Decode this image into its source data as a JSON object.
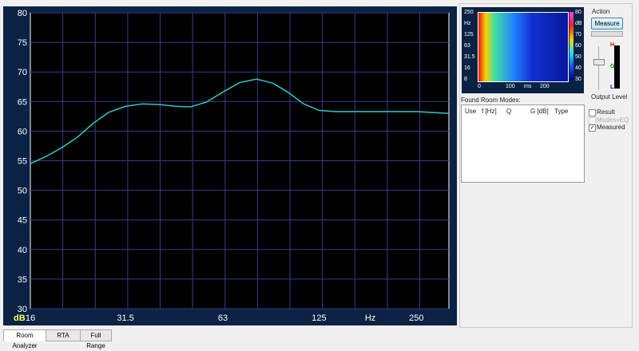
{
  "main_plot": {
    "y_axis_unit": "dB",
    "x_axis_unit": "Hz"
  },
  "chart_data": {
    "type": "line",
    "xscale": "log",
    "xlim": [
      16,
      315
    ],
    "ylim": [
      30,
      80
    ],
    "yticks": [
      "30",
      "35",
      "40",
      "45",
      "50",
      "55",
      "60",
      "65",
      "70",
      "75",
      "80"
    ],
    "xticks": [
      {
        "v": 16,
        "label": "16"
      },
      {
        "v": 31.5,
        "label": "31.5"
      },
      {
        "v": 63,
        "label": "63"
      },
      {
        "v": 125,
        "label": "125"
      },
      {
        "v": 250,
        "label": "250"
      }
    ],
    "xlabel": "Hz",
    "ylabel": "dB",
    "line_color": "#2ec8c8",
    "series": [
      {
        "name": "Measured",
        "x": [
          16,
          18,
          20,
          22.4,
          25,
          28,
          31.5,
          35.5,
          40,
          45,
          50,
          56,
          63,
          71,
          80,
          90,
          100,
          112,
          125,
          140,
          160,
          200,
          250,
          315
        ],
        "y": [
          54.5,
          55.8,
          57.2,
          59,
          61.3,
          63.2,
          64.2,
          64.6,
          64.5,
          64.2,
          64.1,
          64.9,
          66.6,
          68.2,
          68.8,
          68.1,
          66.6,
          64.6,
          63.5,
          63.3,
          63.3,
          63.3,
          63.3,
          63.0
        ]
      }
    ]
  },
  "spectrogram": {
    "y_ticks": [
      "250",
      "Hz",
      "125",
      "63",
      "31.5",
      "16",
      "8"
    ],
    "x_ticks": [
      "0",
      "100",
      "ms",
      "200"
    ],
    "scale_ticks": [
      "80",
      "dB",
      "70",
      "60",
      "50",
      "40",
      "30"
    ]
  },
  "action": {
    "title": "Action",
    "measure_label": "Measure",
    "output_level_label": "Output Level",
    "meter_labels": [
      "H",
      "G",
      "L"
    ]
  },
  "room_modes": {
    "title": "Found Room Modes:",
    "columns": [
      "Use",
      "f [Hz]",
      "Q",
      "G [dB]",
      "Type"
    ]
  },
  "options": [
    {
      "label": "Result",
      "checked": false,
      "enabled": true
    },
    {
      "label": "Modes+EQ",
      "checked": false,
      "enabled": false
    },
    {
      "label": "Measured",
      "checked": true,
      "enabled": true
    }
  ],
  "tabs": [
    "Room Analyzer",
    "RTA",
    "Full Range"
  ]
}
